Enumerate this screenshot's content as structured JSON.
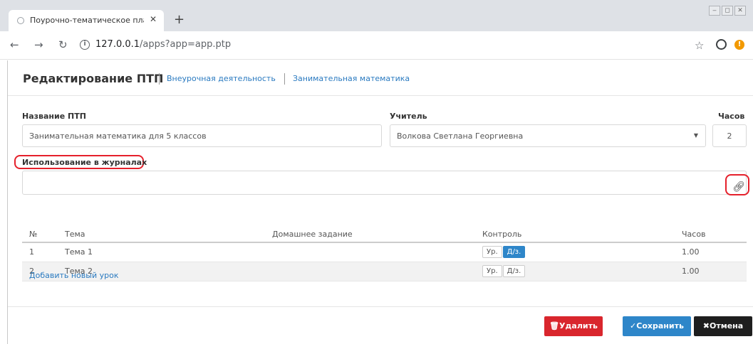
{
  "browser": {
    "tab_title": "Поурочно-тематическое плани",
    "tab_close": "✕",
    "new_tab": "+",
    "url_host": "127.0.0.1",
    "url_rest": "/apps?app=app.ptp",
    "window_controls": [
      "‒",
      "◻",
      "✕"
    ]
  },
  "header": {
    "title": "Редактирование ПТП",
    "breadcrumbs": [
      "Внеурочная деятельность",
      "Занимательная математика"
    ]
  },
  "form": {
    "name_label": "Название ПТП",
    "name_value": "Занимательная математика для 5 классов",
    "teacher_label": "Учитель",
    "teacher_value": "Волкова Светлана Георгиевна",
    "hours_label": "Часов",
    "hours_value": "2",
    "journals_label": "Использование в журналах",
    "journals_value": ""
  },
  "table": {
    "headers": [
      "№",
      "Тема",
      "Домашнее задание",
      "Контроль",
      "Часов"
    ],
    "rows": [
      {
        "num": "1",
        "topic": "Тема 1",
        "homework": "",
        "ctrl_lesson": "Ур.",
        "ctrl_hw": "Д/з.",
        "hours": "1.00"
      },
      {
        "num": "2",
        "topic": "Тема 2",
        "homework": "",
        "ctrl_lesson": "Ур.",
        "ctrl_hw": "Д/з.",
        "hours": "1.00"
      }
    ],
    "add_link": "Добавить новый урок"
  },
  "buttons": {
    "delete": "Удалить",
    "save": "Сохранить",
    "cancel": "Отмена"
  },
  "colors": {
    "accent": "#2e86c9",
    "danger": "#d9262d",
    "highlight": "#e5202b"
  }
}
